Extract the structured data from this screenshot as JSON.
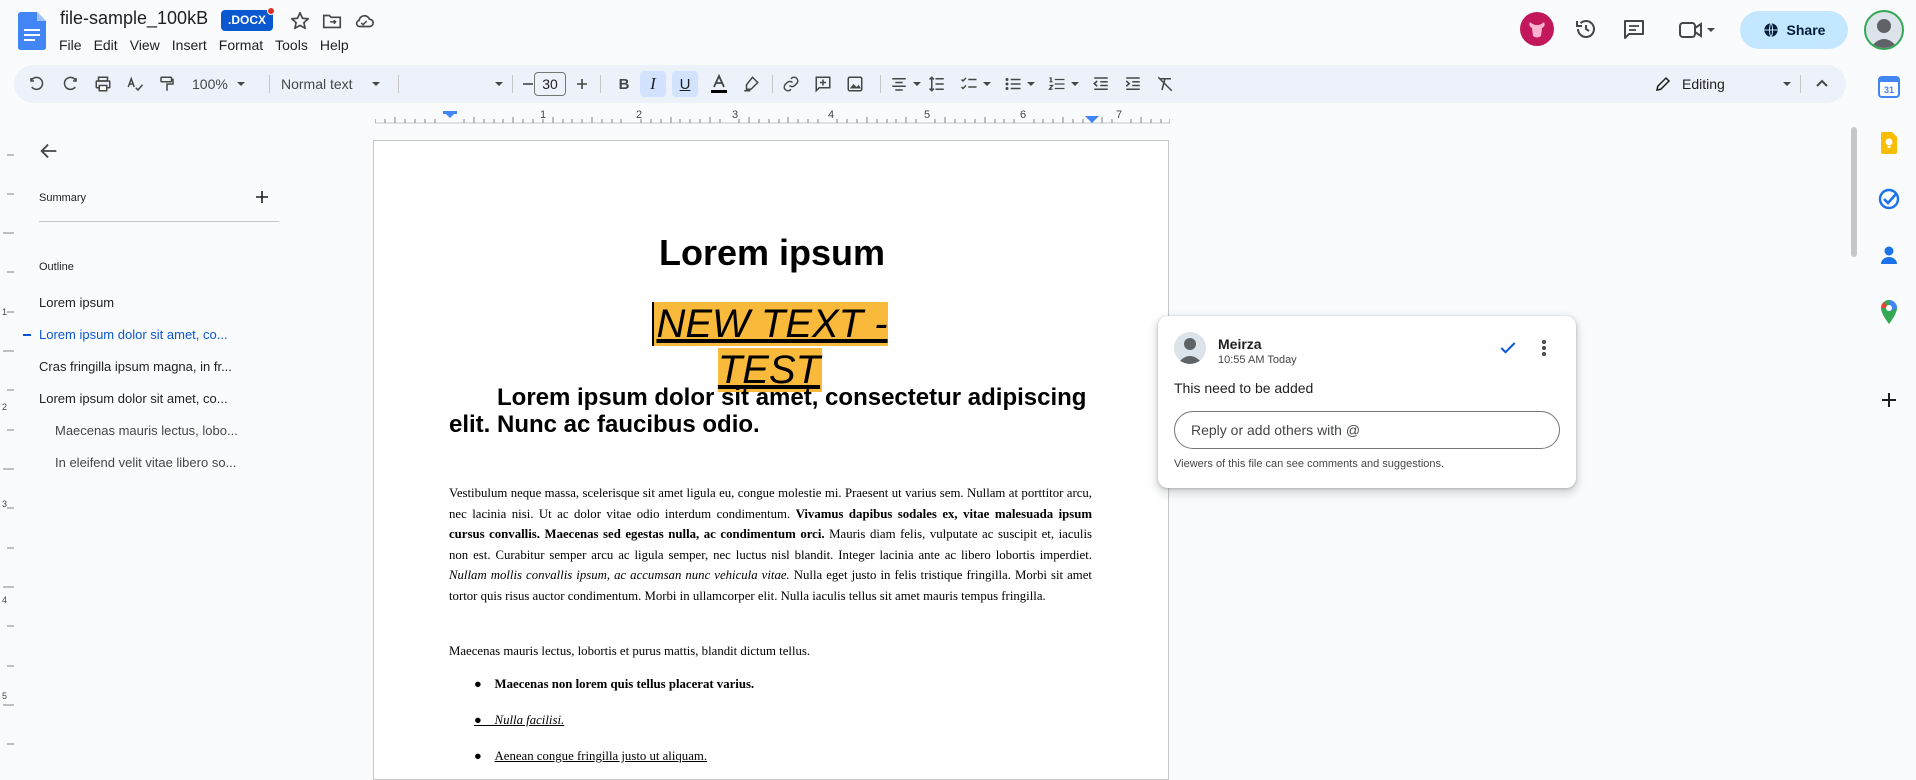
{
  "header": {
    "doc_title": "file-sample_100kB",
    "format_badge": ".DOCX",
    "menus": [
      "File",
      "Edit",
      "View",
      "Insert",
      "Format",
      "Tools",
      "Help"
    ],
    "share_label": "Share"
  },
  "toolbar": {
    "zoom": "100%",
    "style": "Normal text",
    "font": "",
    "font_size": "30",
    "mode": "Editing"
  },
  "ruler": {
    "ticks": [
      "1",
      "2",
      "3",
      "4",
      "5",
      "6",
      "7"
    ]
  },
  "vruler": {
    "ticks": [
      "1",
      "2",
      "3",
      "4",
      "5"
    ]
  },
  "left_panel": {
    "summary_label": "Summary",
    "outline_label": "Outline",
    "outline_items": [
      "Lorem ipsum",
      "Lorem ipsum dolor sit amet, co...",
      "Cras fringilla ipsum magna, in fr...",
      "Lorem ipsum dolor sit amet, co...",
      "Maecenas mauris lectus, lobo...",
      "In eleifend velit vitae libero so..."
    ]
  },
  "document": {
    "title": "Lorem ipsum",
    "highlight_text": "NEW TEXT - TEST",
    "heading": "Lorem ipsum dolor sit amet, consectetur adipiscing elit. Nunc ac faucibus odio.",
    "p1_a": "Vestibulum neque massa, scelerisque sit amet ligula eu, congue molestie mi. Praesent ut varius sem. Nullam at porttitor arcu, nec lacinia nisi. Ut ac dolor vitae odio interdum condimentum. ",
    "p1_bold": "Vivamus dapibus sodales ex, vitae malesuada ipsum cursus convallis. Maecenas sed egestas nulla, ac condimentum orci.",
    "p1_b": " Mauris diam felis, vulputate ac suscipit et, iaculis non est. Curabitur semper arcu ac ligula semper, nec luctus nisl blandit. Integer lacinia ante ac libero lobortis imperdiet. ",
    "p1_italic": "Nullam mollis convallis ipsum, ac accumsan nunc vehicula vitae.",
    "p1_c": " Nulla eget justo in felis tristique fringilla. Morbi sit amet tortor quis risus auctor condimentum. Morbi in ullamcorper elit. Nulla iaculis tellus sit amet mauris tempus fringilla.",
    "p2": "Maecenas mauris lectus, lobortis et purus mattis, blandit dictum tellus.",
    "bullets": [
      "Maecenas non lorem quis tellus placerat varius.",
      "Nulla facilisi.",
      "Aenean congue fringilla justo ut aliquam."
    ]
  },
  "comment": {
    "author": "Meirza",
    "time": "10:55 AM Today",
    "text": "This need to be added",
    "reply_placeholder": "Reply or add others with @",
    "footer": "Viewers of this file can see comments and suggestions."
  },
  "colors": {
    "accent": "#0b57d0",
    "highlight": "#f9b93a",
    "toolbar_bg": "#edf2fa",
    "share_bg": "#c2e7ff"
  }
}
